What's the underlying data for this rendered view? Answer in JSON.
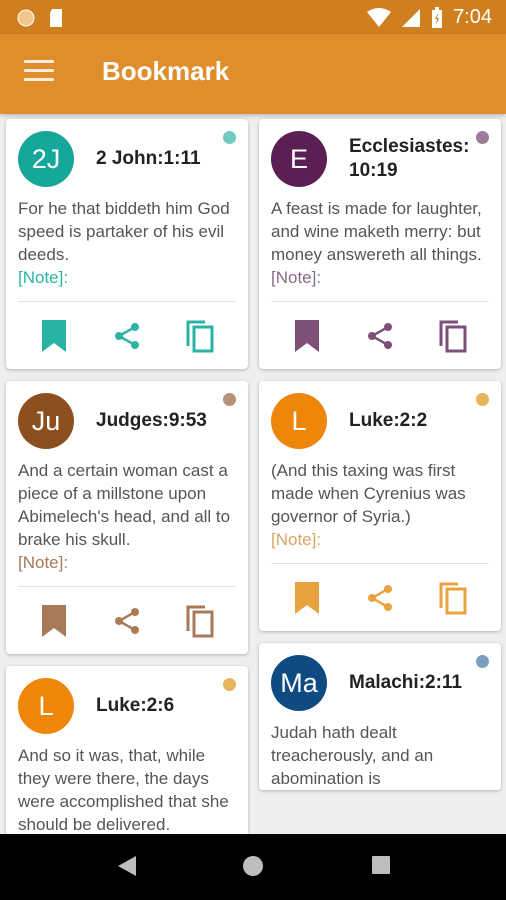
{
  "status_bar": {
    "time": "7:04"
  },
  "app_bar": {
    "title": "Bookmark"
  },
  "cards_left": [
    {
      "initials": "2J",
      "reference": "2 John:1:11",
      "color": "#15a89a",
      "text": "For he that biddeth him God speed is partaker of his evil deeds.",
      "note": "[Note]:"
    },
    {
      "initials": "Ju",
      "reference": "Judges:9:53",
      "color": "#8d4f1d",
      "text": "And a certain woman cast a piece of a millstone upon Abimelech's head, and all to brake his skull.",
      "note": "[Note]:"
    },
    {
      "initials": "L",
      "reference": "Luke:2:6",
      "color": "#ee860a",
      "text": "And so it was, that, while they were there, the days were accomplished that she should be delivered.",
      "note": ""
    }
  ],
  "cards_right": [
    {
      "initials": "E",
      "reference": "Ecclesiastes: 10:19",
      "color": "#5c1f53",
      "text": "A feast is made for laughter, and wine maketh merry: but money answereth all things.",
      "note": "[Note]:"
    },
    {
      "initials": "L",
      "reference": "Luke:2:2",
      "color": "#ee860a",
      "text": "(And this taxing was first made when Cyrenius was governor of Syria.)",
      "note": "[Note]:"
    },
    {
      "initials": "Ma",
      "reference": "Malachi:2:11",
      "color": "#0d4b82",
      "text": "Judah hath dealt treacherously, and an abomination is",
      "note": ""
    }
  ],
  "card_colors": {
    "teal": "#2ab3a4",
    "brown": "#a87a58",
    "orange": "#e8a23f",
    "purple": "#7e4f78"
  },
  "icons": [
    "bookmark-icon",
    "share-icon",
    "copy-icon",
    "back-icon",
    "home-icon",
    "recents-icon"
  ]
}
